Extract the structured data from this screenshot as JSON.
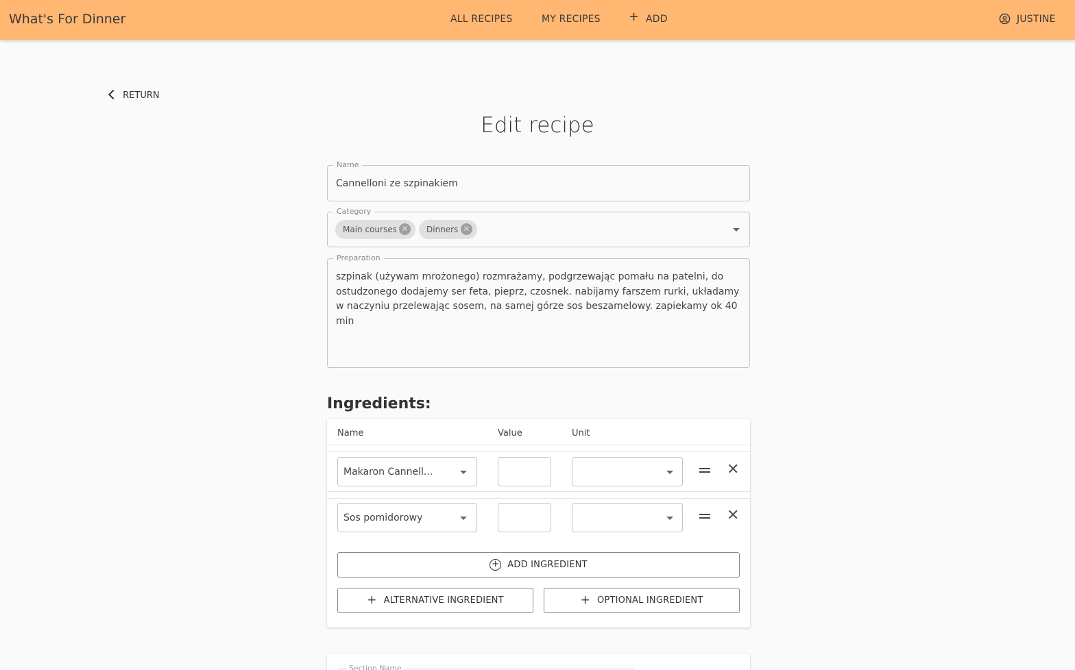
{
  "header": {
    "brand": "What's For Dinner",
    "nav": {
      "all_recipes": "ALL RECIPES",
      "my_recipes": "MY RECIPES",
      "add": "ADD"
    },
    "user": "JUSTINE"
  },
  "return_label": "RETURN",
  "page_title": "Edit recipe",
  "form": {
    "name": {
      "label": "Name",
      "value": "Cannelloni ze szpinakiem"
    },
    "category": {
      "label": "Category",
      "chips": [
        "Main courses",
        "Dinners"
      ]
    },
    "preparation": {
      "label": "Preparation",
      "value": "szpinak (używam mrożonego) rozmrażamy, podgrzewając pomału na patelni, do ostudzonego dodajemy ser feta, pieprz, czosnek. nabijamy farszem rurki, układamy w naczyniu przelewając sosem, na samej górze sos beszamelowy. zapiekamy ok 40 min"
    }
  },
  "ingredients": {
    "title": "Ingredients:",
    "columns": {
      "name": "Name",
      "value": "Value",
      "unit": "Unit"
    },
    "rows": [
      {
        "name": "Makaron Cannell...",
        "value": "",
        "unit": ""
      },
      {
        "name": "Sos pomidorowy",
        "value": "",
        "unit": ""
      }
    ],
    "add_label": "ADD INGREDIENT",
    "alternative_label": "ALTERNATIVE INGREDIENT",
    "optional_label": "OPTIONAL INGREDIENT"
  },
  "section": {
    "name_label": "Section Name"
  },
  "colors": {
    "appbar": "#ffb772"
  },
  "icons": {
    "add": "plus-icon",
    "user": "account-circle-icon",
    "return": "chevron-left-icon",
    "chip_delete": "cancel-icon",
    "dropdown": "caret-down-icon",
    "drag": "drag-handle-icon",
    "remove": "close-icon",
    "add_ingredient": "add-circle-outline-icon"
  }
}
